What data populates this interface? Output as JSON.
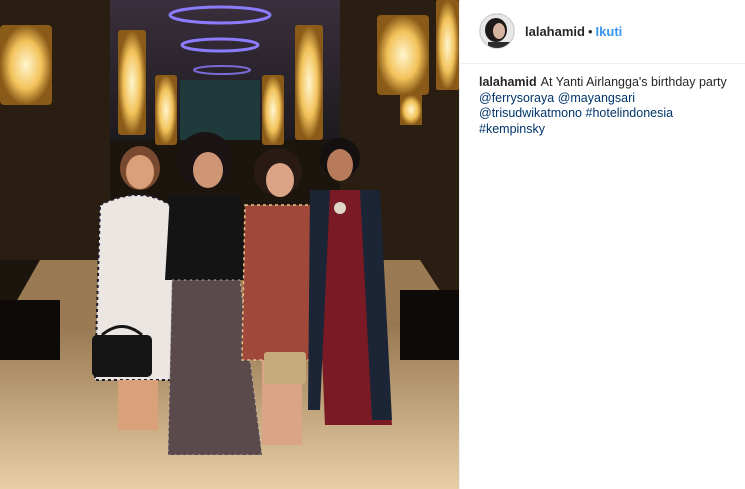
{
  "post": {
    "username": "lalahamid",
    "separator": "•",
    "follow_label": "Ikuti",
    "caption_username": "lalahamid",
    "caption_text": "At Yanti Airlangga's birthday party",
    "caption_tags": [
      "@ferrysoraya",
      "@mayangsari",
      "@trisudwikatmono",
      "#hotelindonesia",
      "#kempinsky"
    ]
  },
  "colors": {
    "link_blue": "#3897f0",
    "tag_navy": "#003569",
    "text_dark": "#262626"
  },
  "icons": {
    "avatar": "profile-photo"
  }
}
